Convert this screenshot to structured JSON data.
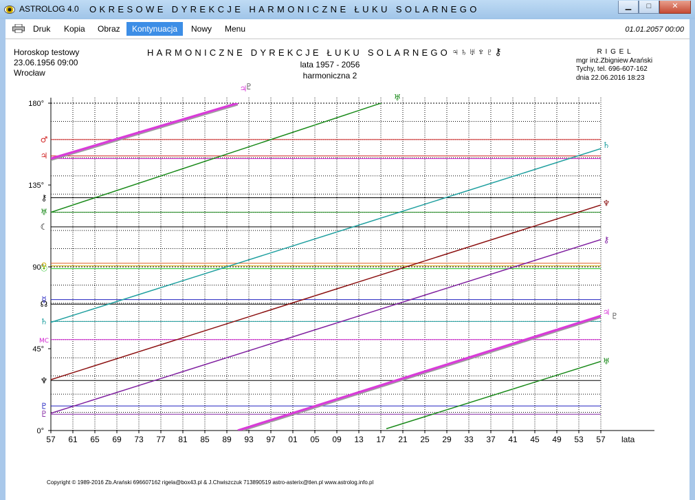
{
  "window": {
    "app_name": "ASTROLOG 4.0",
    "title": "OKRESOWE DYREKCJE HARMONICZNE ŁUKU SOLARNEGO",
    "minimize": "▁",
    "maximize": "□",
    "close": "✕"
  },
  "menu": {
    "items": [
      "Druk",
      "Kopia",
      "Obraz",
      "Kontynuacja",
      "Nowy",
      "Menu"
    ],
    "active": "Kontynuacja",
    "datetime": "01.01.2057 00:00"
  },
  "header": {
    "left": [
      "Horoskop testowy",
      "23.06.1956 09:00",
      "Wrocław"
    ],
    "title": "HARMONICZNE DYREKCJE ŁUKU SOLARNEGO",
    "title_glyphs": "♃♄♅♆♇⚷",
    "years": "lata  1957  -  2056",
    "harmonic": "harmoniczna 2",
    "right": [
      "R I G E L",
      "mgr inż.Zbigniew Arański",
      "Tychy, tel. 696-607-162",
      "dnia 22.06.2016 18:23"
    ]
  },
  "footer": {
    "copyright": "Copyright © 1989-2016 Zb.Arański 696607162 rigela@box43.pl & J.Chwiszczuk 713890519 astro-asterix@tlen.pl www.astrolog.info.pl"
  },
  "chart_data": {
    "type": "line",
    "x_start_year": 1957,
    "x_end_year": 2057,
    "x_tick_step": 4,
    "xlabel": "lata",
    "ylim": [
      0,
      180
    ],
    "y_ticks": [
      0,
      45,
      90,
      135,
      180
    ],
    "y_tick_labels": [
      "0°",
      "45°",
      "90°",
      "135°",
      "180°"
    ],
    "grid": true,
    "natal_lines": [
      {
        "glyph": "♂",
        "value": 160,
        "color": "#d02020"
      },
      {
        "glyph": "♃",
        "value": 151,
        "color": "#d02020"
      },
      {
        "glyph": "",
        "value": 149.5,
        "color": "#d020d0"
      },
      {
        "glyph": "⚷",
        "value": 128,
        "color": "#000000"
      },
      {
        "glyph": "♅",
        "value": 120,
        "color": "#1a8a1a"
      },
      {
        "glyph": "☾",
        "value": 112,
        "color": "#000000"
      },
      {
        "glyph": "",
        "value": 92,
        "color": "#e06020"
      },
      {
        "glyph": "♀",
        "value": 90.5,
        "color": "#ccaa00"
      },
      {
        "glyph": "☉",
        "value": 89,
        "color": "#20c020"
      },
      {
        "glyph": "☊",
        "value": 69.5,
        "color": "#000000"
      },
      {
        "glyph": "☿",
        "value": 72,
        "color": "#2020c0"
      },
      {
        "glyph": "♄",
        "value": 60,
        "color": "#20a0a0"
      },
      {
        "glyph": "MC",
        "value": 50,
        "color": "#d020d0"
      },
      {
        "glyph": "♆",
        "value": 27.5,
        "color": "#000000"
      },
      {
        "glyph": "♇",
        "value": 13.5,
        "color": "#2020c0"
      },
      {
        "glyph": "♇",
        "value": 9,
        "color": "#8020a0"
      }
    ],
    "series": [
      {
        "name": "♃",
        "color": "#d83cd8",
        "width": 3.5,
        "glyph": "♃",
        "points": [
          [
            1957,
            149.5
          ],
          [
            1991,
            180
          ],
          [
            1991,
            0.0
          ],
          [
            2057,
            63
          ]
        ]
      },
      {
        "name": "♇",
        "color": "#999999",
        "width": 1.5,
        "glyph": "♇",
        "points": [
          [
            1957,
            148.5
          ],
          [
            1991,
            179
          ],
          [
            1991,
            -1
          ],
          [
            2057,
            62
          ]
        ]
      },
      {
        "name": "♅",
        "color": "#1a8a1a",
        "width": 1.5,
        "glyph": "♅",
        "points": [
          [
            1957,
            120
          ],
          [
            2018,
            181
          ],
          [
            2018,
            1
          ],
          [
            2057,
            38
          ]
        ]
      },
      {
        "name": "♄",
        "color": "#20a0a0",
        "width": 1.5,
        "glyph": "♄",
        "points": [
          [
            1957,
            59.5
          ],
          [
            2057,
            155
          ]
        ]
      },
      {
        "name": "♆",
        "color": "#8b1010",
        "width": 1.5,
        "glyph": "♆",
        "points": [
          [
            1957,
            28
          ],
          [
            2057,
            124
          ]
        ]
      },
      {
        "name": "⚷",
        "color": "#8020a0",
        "width": 1.5,
        "glyph": "⚷",
        "points": [
          [
            1957,
            9.5
          ],
          [
            2057,
            105
          ]
        ]
      }
    ],
    "end_labels": [
      {
        "glyph": "♃",
        "color": "#d83cd8",
        "year": 1992,
        "value": 188
      },
      {
        "glyph": "♇",
        "color": "#555555",
        "year": 1993,
        "value": 189
      },
      {
        "glyph": "♅",
        "color": "#1a8a1a",
        "year": 2020,
        "value": 183
      },
      {
        "glyph": "♄",
        "color": "#20a0a0",
        "year": 2058,
        "value": 157
      },
      {
        "glyph": "♆",
        "color": "#8b1010",
        "year": 2058,
        "value": 125
      },
      {
        "glyph": "⚷",
        "color": "#8020a0",
        "year": 2058,
        "value": 105
      },
      {
        "glyph": "♃",
        "color": "#d83cd8",
        "year": 2058,
        "value": 65
      },
      {
        "glyph": "♇",
        "color": "#555555",
        "year": 2059.5,
        "value": 63
      },
      {
        "glyph": "♅",
        "color": "#1a8a1a",
        "year": 2058,
        "value": 38
      }
    ]
  }
}
